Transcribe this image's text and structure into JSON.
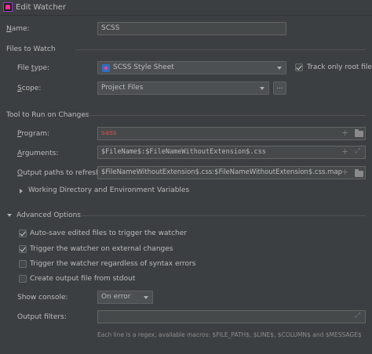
{
  "window": {
    "title": "Edit Watcher"
  },
  "name": {
    "label": "Name:",
    "value": "SCSS"
  },
  "files_to_watch": {
    "section_title": "Files to Watch",
    "file_type_label": "File type:",
    "file_type_value": "SCSS Style Sheet",
    "track_only_root_label": "Track only root files",
    "track_only_root_checked": true,
    "scope_label": "Scope:",
    "scope_value": "Project Files",
    "scope_button": "..."
  },
  "tool": {
    "section_title": "Tool to Run on Changes",
    "program_label": "Program:",
    "program_value": "sass",
    "arguments_label": "Arguments:",
    "arguments_value": "$FileName$:$FileNameWithoutExtension$.css",
    "output_paths_label": "Output paths to refresh:",
    "output_paths_value": "$FileNameWithoutExtension$.css:$FileNameWithoutExtension$.css.map",
    "working_dir_label": "Working Directory and Environment Variables"
  },
  "advanced": {
    "section_title": "Advanced Options",
    "options": [
      {
        "label": "Auto-save edited files to trigger the watcher",
        "checked": true
      },
      {
        "label": "Trigger the watcher on external changes",
        "checked": true
      },
      {
        "label": "Trigger the watcher regardless of syntax errors",
        "checked": false
      },
      {
        "label": "Create output file from stdout",
        "checked": false
      }
    ],
    "show_console_label": "Show console:",
    "show_console_value": "On error",
    "output_filters_label": "Output filters:",
    "output_filters_value": "",
    "hint": "Each line is a regex, available macros: $FILE_PATH$, $LINE$, $COLUMN$ and $MESSAGE$"
  },
  "colors": {
    "background": "#3c3f41",
    "field": "#45494a",
    "error_text": "#d25252"
  },
  "icons": [
    "app-icon",
    "css-file-icon",
    "plus-icon",
    "folder-icon",
    "expand-icon",
    "chevron-down-icon",
    "checkbox-icon"
  ]
}
